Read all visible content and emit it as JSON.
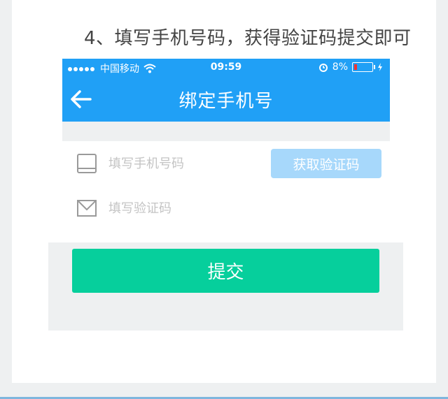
{
  "instruction": "4、填写手机号码，获得验证码提交即可",
  "status_bar": {
    "carrier": "中国移动",
    "time": "09:59",
    "battery": "8%"
  },
  "nav": {
    "title": "绑定手机号"
  },
  "form": {
    "phone_placeholder": "填写手机号码",
    "code_placeholder": "填写验证码",
    "get_code_button": "获取验证码",
    "submit_button": "提交"
  },
  "colors": {
    "brand_blue": "#20a0f6",
    "get_code_bg": "#a7d8fb",
    "submit_green": "#06cf9c"
  },
  "icons": {
    "back": "arrow-left-icon",
    "phone": "phone-device-icon",
    "code": "envelope-icon"
  }
}
